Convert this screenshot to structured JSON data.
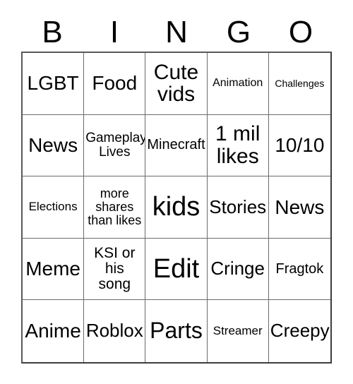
{
  "card": {
    "header_letters": [
      "B",
      "I",
      "N",
      "G",
      "O"
    ],
    "columns": 5,
    "rows": 5,
    "border_color": "#6b6b6b",
    "background_color": "#ffffff",
    "text_color": "#000000",
    "cells": [
      [
        {
          "text": "LGBT",
          "size": "fs-ml"
        },
        {
          "text": "Food",
          "size": "fs-ml"
        },
        {
          "text": "Cute\nvids",
          "size": "fs-l"
        },
        {
          "text": "Animation",
          "size": "fs-xxs2"
        },
        {
          "text": "Challenges",
          "size": "fs-tiny"
        }
      ],
      [
        {
          "text": "News",
          "size": "fs-ml"
        },
        {
          "text": "Gameplay\nLives",
          "size": "fs-xs"
        },
        {
          "text": "Minecraft",
          "size": "fs-s"
        },
        {
          "text": "1 mil\nlikes",
          "size": "fs-l"
        },
        {
          "text": "10/10",
          "size": "fs-ml"
        }
      ],
      [
        {
          "text": "Elections",
          "size": "fs-xxs"
        },
        {
          "text": "more\nshares\nthan likes",
          "size": "fs-xs2"
        },
        {
          "text": "kids",
          "size": "fs-xxl"
        },
        {
          "text": "Stories",
          "size": "fs-m"
        },
        {
          "text": "News",
          "size": "fs-ml"
        }
      ],
      [
        {
          "text": "Meme",
          "size": "fs-ml"
        },
        {
          "text": "KSI or\nhis\nsong",
          "size": "fs-sm"
        },
        {
          "text": "Edit",
          "size": "fs-xxl"
        },
        {
          "text": "Cringe",
          "size": "fs-m"
        },
        {
          "text": "Fragtok",
          "size": "fs-s"
        }
      ],
      [
        {
          "text": "Anime",
          "size": "fs-ml"
        },
        {
          "text": "Roblox",
          "size": "fs-m"
        },
        {
          "text": "Parts",
          "size": "fs-xl"
        },
        {
          "text": "Streamer",
          "size": "fs-xxs"
        },
        {
          "text": "Creepy",
          "size": "fs-m"
        }
      ]
    ]
  }
}
